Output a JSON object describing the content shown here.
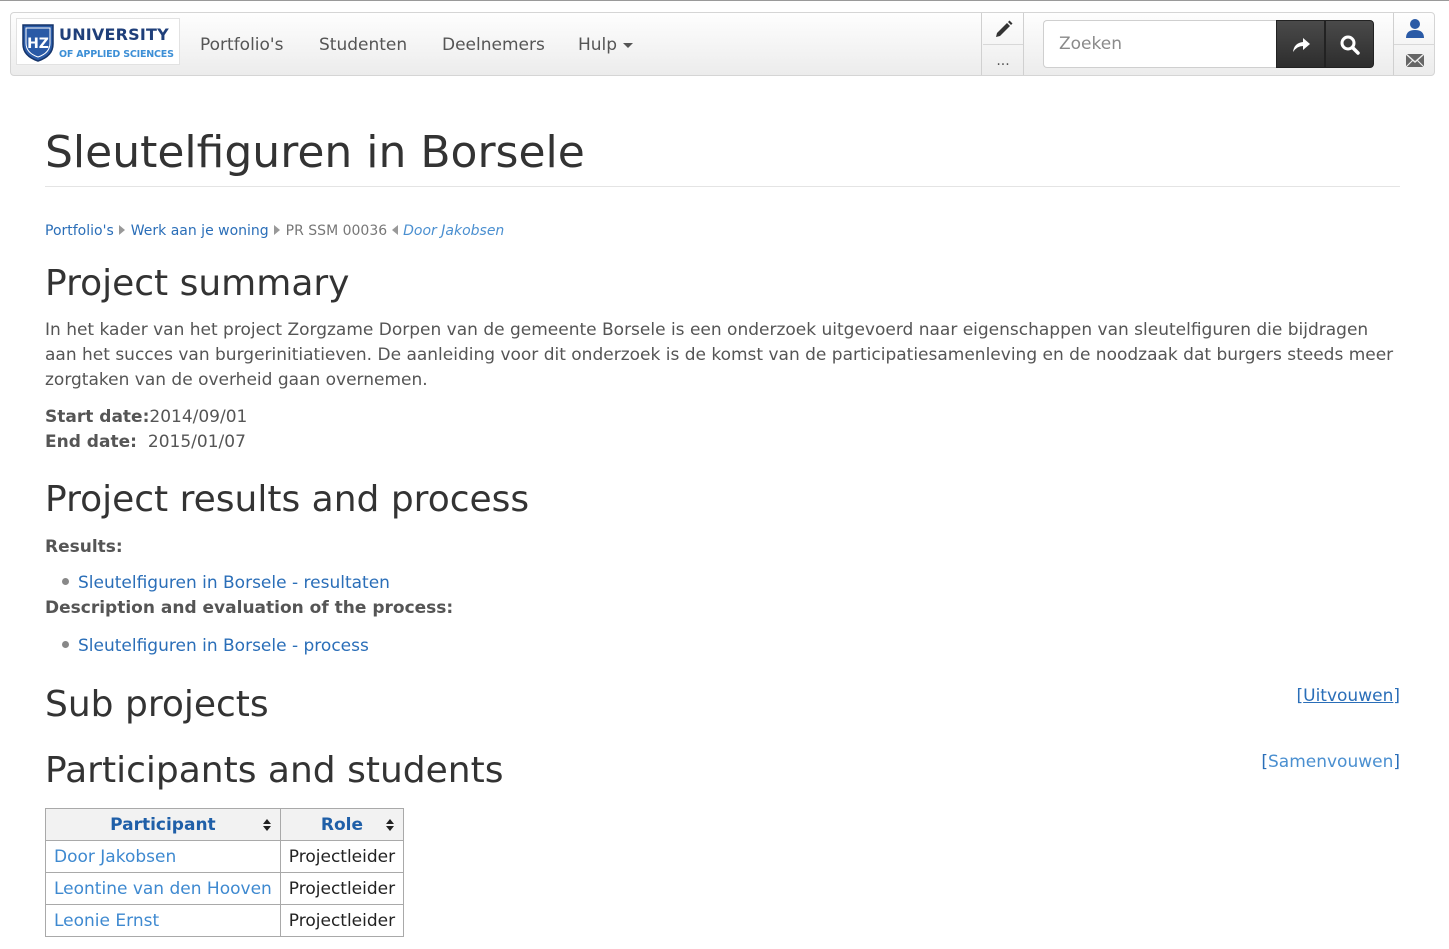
{
  "navbar": {
    "logo_line1": "UNIVERSITY",
    "logo_line2": "OF APPLIED SCIENCES",
    "logo_monogram": "HZ",
    "links": [
      "Portfolio's",
      "Studenten",
      "Deelnemers",
      "Hulp"
    ],
    "edit_icon": "pencil-icon",
    "more_label": "...",
    "search_placeholder": "Zoeken",
    "go_icon": "share-arrow-icon",
    "search_icon": "search-icon",
    "user_icon": "user-icon",
    "mail_icon": "envelope-icon"
  },
  "page": {
    "title": "Sleutelfiguren in Borsele"
  },
  "breadcrumb": {
    "items": [
      "Portfolio's",
      "Werk aan je woning",
      "PR SSM 00036"
    ],
    "author": "Door Jakobsen"
  },
  "summary": {
    "heading": "Project summary",
    "text": "In het kader van het project Zorgzame Dorpen van de gemeente Borsele is een onderzoek uitgevoerd naar eigenschappen van sleutelfiguren die bijdragen aan het succes van burgerinitiatieven. De aanleiding voor dit onderzoek is de komst van de participatiesamenleving en de noodzaak dat burgers steeds meer zorgtaken van de overheid gaan overnemen.",
    "start_label": "Start date:",
    "start_value": "2014/09/01",
    "end_label": "End date:",
    "end_value": "2015/01/07"
  },
  "results": {
    "heading": "Project results and process",
    "results_label": "Results:",
    "results_link": "Sleutelfiguren in Borsele - resultaten",
    "process_label": "Description and evaluation of the process:",
    "process_link": "Sleutelfiguren in Borsele - process"
  },
  "subprojects": {
    "heading": "Sub projects",
    "toggle_open": "[",
    "toggle_label": "Uitvouwen",
    "toggle_close": "]"
  },
  "participants": {
    "heading": "Participants and students",
    "toggle_open": "[",
    "toggle_label": "Samenvouwen",
    "toggle_close": "]",
    "columns": [
      "Participant",
      "Role"
    ],
    "rows": [
      [
        "Door Jakobsen",
        "Projectleider"
      ],
      [
        "Leontine van den Hooven",
        "Projectleider"
      ],
      [
        "Leonie Ernst",
        "Projectleider"
      ]
    ]
  },
  "colors": {
    "link": "#2a6eb8",
    "link_light": "#3e89d0",
    "text": "#333333",
    "muted": "#555555",
    "search_button": "#333333"
  }
}
